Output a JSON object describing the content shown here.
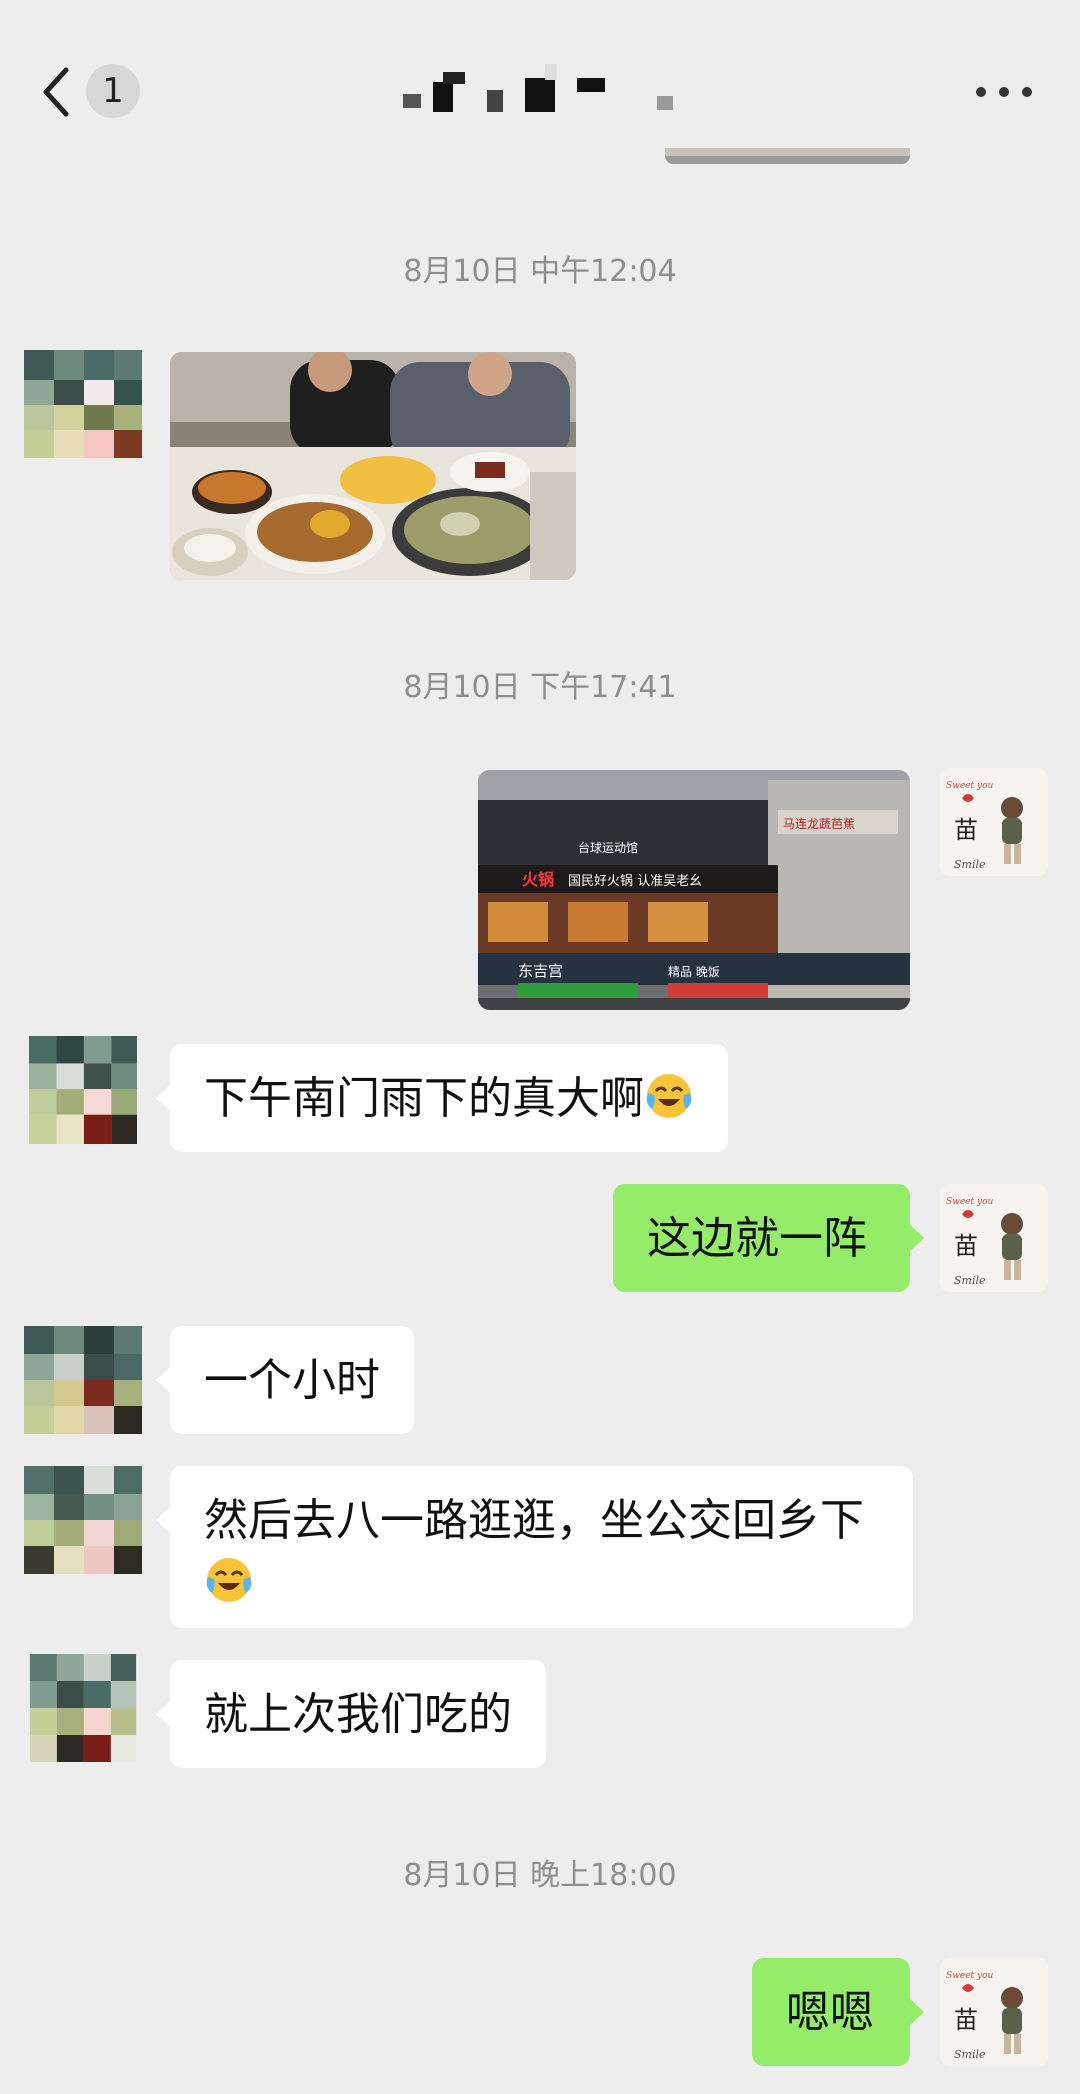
{
  "header": {
    "unread_count": "1",
    "contact_name_hidden": true
  },
  "timestamps": [
    "8月10日 中午12:04",
    "8月10日 下午17:41",
    "8月10日 晚上18:00"
  ],
  "messages": [
    {
      "from": "other",
      "type": "image",
      "subject": "restaurant-table-photo"
    },
    {
      "from": "me",
      "type": "image",
      "subject": "street-storefront-photo"
    },
    {
      "from": "other",
      "type": "text",
      "text": "下午南门雨下的真大啊",
      "emoji": "crying-laughing-emoji"
    },
    {
      "from": "me",
      "type": "text",
      "text": "这边就一阵"
    },
    {
      "from": "other",
      "type": "text",
      "text": "一个小时"
    },
    {
      "from": "other",
      "type": "text",
      "text": "然后去八一路逛逛，坐公交回乡下",
      "emoji": "crying-laughing-emoji"
    },
    {
      "from": "other",
      "type": "text",
      "text": "就上次我们吃的"
    },
    {
      "from": "me",
      "type": "text",
      "text": "嗯嗯"
    }
  ],
  "my_avatar": {
    "char": "苗",
    "script_top": "Sweet you",
    "script_bottom": "Smile"
  },
  "storefront_signs": {
    "s1": "火锅",
    "s2": "台球运动馆",
    "s3": "国民好火锅 认准吴老幺",
    "s4": "东吉宫",
    "s5": "精品 晚饭",
    "s6": "马连龙蔬芭蕉"
  },
  "colors": {
    "background": "#ededed",
    "bubble_me": "#95ec69",
    "bubble_other": "#ffffff",
    "timestamp": "#8e8e8e"
  }
}
